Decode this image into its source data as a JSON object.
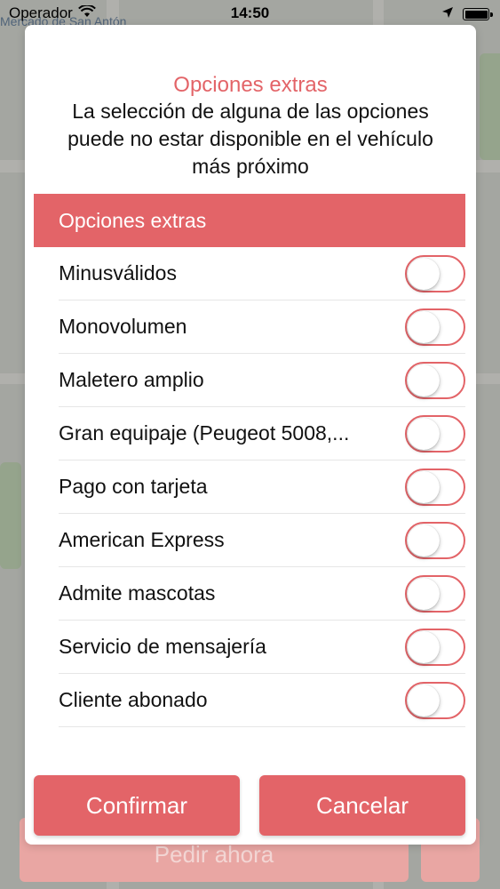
{
  "status_bar": {
    "carrier": "Operador",
    "time": "14:50",
    "map_label": "Mercado de San Antón"
  },
  "background": {
    "order_button_label": "Pedir ahora"
  },
  "modal": {
    "title": "Opciones extras",
    "description": "La selección de alguna de las opciones puede no estar disponible en el vehículo más próximo",
    "section_header": "Opciones extras",
    "options": [
      {
        "label": "Minusválidos",
        "enabled": false
      },
      {
        "label": "Monovolumen",
        "enabled": false
      },
      {
        "label": "Maletero amplio",
        "enabled": false
      },
      {
        "label": "Gran equipaje (Peugeot 5008,...",
        "enabled": false
      },
      {
        "label": "Pago con tarjeta",
        "enabled": false
      },
      {
        "label": "American Express",
        "enabled": false
      },
      {
        "label": "Admite mascotas",
        "enabled": false
      },
      {
        "label": "Servicio de mensajería",
        "enabled": false
      },
      {
        "label": "Cliente abonado",
        "enabled": false
      }
    ],
    "confirm_label": "Confirmar",
    "cancel_label": "Cancelar"
  },
  "colors": {
    "accent": "#e36468",
    "text": "#111111"
  }
}
